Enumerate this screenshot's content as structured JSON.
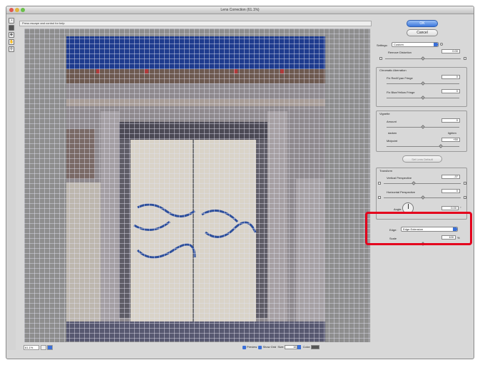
{
  "window": {
    "title": "Lens Correction (61.1%)"
  },
  "hint": "Press escape and control for help",
  "tools": [
    "remove-distortion-tool",
    "straighten-tool",
    "move-grid-tool",
    "hand-tool",
    "zoom-tool"
  ],
  "buttons": {
    "ok": "OK",
    "cancel": "Cancel",
    "set_lens_default": "Set Lens Default"
  },
  "settings": {
    "label": "Settings:",
    "value": "Custom"
  },
  "remove_distortion": {
    "label": "Remove Distortion",
    "value": "0.00"
  },
  "chromatic": {
    "title": "Chromatic Aberration",
    "red_cyan": {
      "label": "Fix Red/Cyan Fringe",
      "value": "0"
    },
    "blue_yellow": {
      "label": "Fix Blue/Yellow Fringe",
      "value": "0"
    }
  },
  "vignette": {
    "title": "Vignette",
    "amount": {
      "label": "Amount",
      "value": "0"
    },
    "darken": "darken",
    "lighten": "lighten",
    "midpoint": {
      "label": "Midpoint",
      "value": "+50"
    }
  },
  "transform": {
    "title": "Transform",
    "vertical": {
      "label": "Vertical Perspective",
      "value": "-37"
    },
    "horizontal": {
      "label": "Horizontal Perspective",
      "value": "0"
    },
    "angle": {
      "label": "Angle:",
      "value": "0.00"
    }
  },
  "edge": {
    "label": "Edge:",
    "value": "Edge Extension"
  },
  "scale": {
    "label": "Scale",
    "value": "100",
    "unit": "%"
  },
  "status": {
    "zoom": "61.1%",
    "preview": "Preview",
    "show_grid": "Show Grid",
    "size_label": "Size:",
    "size_value": "16",
    "color_label": "Color:"
  },
  "colors": {
    "accent": "#3a6fd8",
    "highlight": "#e4001d",
    "sky": "#1f3c8e"
  }
}
